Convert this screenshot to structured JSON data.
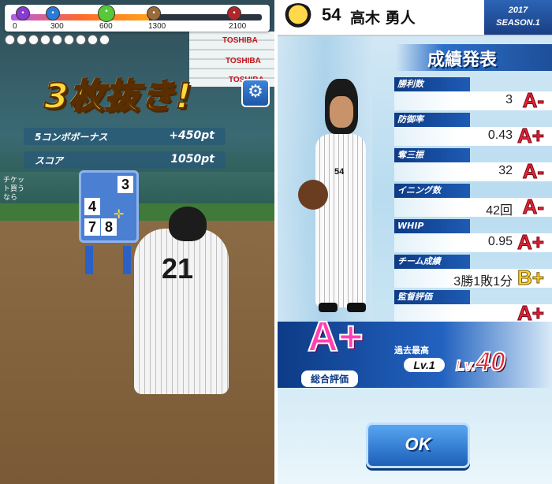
{
  "left": {
    "progress": {
      "fraction": 0.55,
      "tick_labels": [
        "0",
        "300",
        "600",
        "1300",
        "2100"
      ]
    },
    "remaining_balls": 9,
    "ad_boards": [
      "TOSHIBA",
      "TOSHIBA",
      "TOSHIBA"
    ],
    "combo_title": "3枚抜き!",
    "combo_bonus_label": "5コンボボーナス",
    "combo_bonus_value": "+450pt",
    "score_label": "スコア",
    "score_value": "1050pt",
    "panel_numbers": [
      "3",
      "4",
      "7",
      "8"
    ],
    "ticket_ad": "チケット買うなら",
    "batter_number": "21"
  },
  "right": {
    "player_number": "54",
    "player_name": "高木 勇人",
    "season_year": "2017",
    "season_label": "SEASON.1",
    "header": "成績発表",
    "stats": [
      {
        "label": "勝利数",
        "value": "3",
        "grade": "A-"
      },
      {
        "label": "防御率",
        "value": "0.43",
        "grade": "A+"
      },
      {
        "label": "奪三振",
        "value": "32",
        "grade": "A-"
      },
      {
        "label": "イニング数",
        "value": "42回",
        "grade": "A-"
      },
      {
        "label": "WHIP",
        "value": "0.95",
        "grade": "A+"
      },
      {
        "label": "チーム成績",
        "value": "3勝1敗1分",
        "grade": "B+"
      },
      {
        "label": "監督評価",
        "value": "",
        "grade": "A+"
      }
    ],
    "overall_grade": "A+",
    "overall_label": "総合評価",
    "past_best_label": "過去最高",
    "past_level": "Lv.1",
    "new_level_prefix": "Lv.",
    "new_level_number": "40",
    "ok_label": "OK",
    "jersey_number": "54"
  },
  "colors": {
    "accent_blue": "#1d56a8",
    "grade_red": "#e02636",
    "title_gold": "#ffd83a"
  }
}
